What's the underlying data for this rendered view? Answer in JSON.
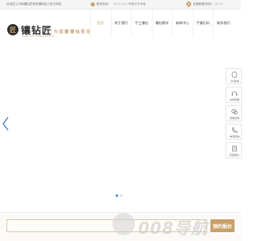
{
  "topbar": {
    "welcome": "欢迎进入济南镶钻匠珠宝镶嵌加工官方网站",
    "hotline_label": "服务热线：",
    "hotline_value": "0531-18-01",
    "hotline_note": "节假日不休息",
    "location_label": "全国客服热线：",
    "location_value": "18...8424..."
  },
  "header": {
    "logo_mark": "匠",
    "logo_text": "镶钻匠",
    "logo_sub": "XIAN ZU JIANGCRAFTS",
    "slogan": "为 您 雕 镶 钻 而 生"
  },
  "nav": {
    "items": [
      {
        "label": "首页",
        "active": true
      },
      {
        "label": "关于我们",
        "active": false
      },
      {
        "label": "手工镶钻",
        "active": false
      },
      {
        "label": "镶钻教学",
        "active": false
      },
      {
        "label": "新闻中心",
        "active": false
      },
      {
        "label": "手镶石料",
        "active": false
      },
      {
        "label": "联系我们",
        "active": false
      }
    ]
  },
  "float": {
    "items": [
      {
        "label": "QQ咨询",
        "icon": "qq-icon"
      },
      {
        "label": "在线客服",
        "icon": "headset-icon"
      },
      {
        "label": "微信咨询",
        "icon": "wechat-icon"
      },
      {
        "label": "电话咨询",
        "icon": "phone-icon"
      },
      {
        "label": "获取报价",
        "icon": "quote-icon"
      }
    ]
  },
  "bottom": {
    "search_placeholder": "",
    "search_button": "预约报价"
  },
  "watermark": {
    "text": "008导航"
  },
  "colors": {
    "gold": "#c8a06a",
    "dark": "#2b2b2b",
    "dot_active": "#4a90d9"
  }
}
